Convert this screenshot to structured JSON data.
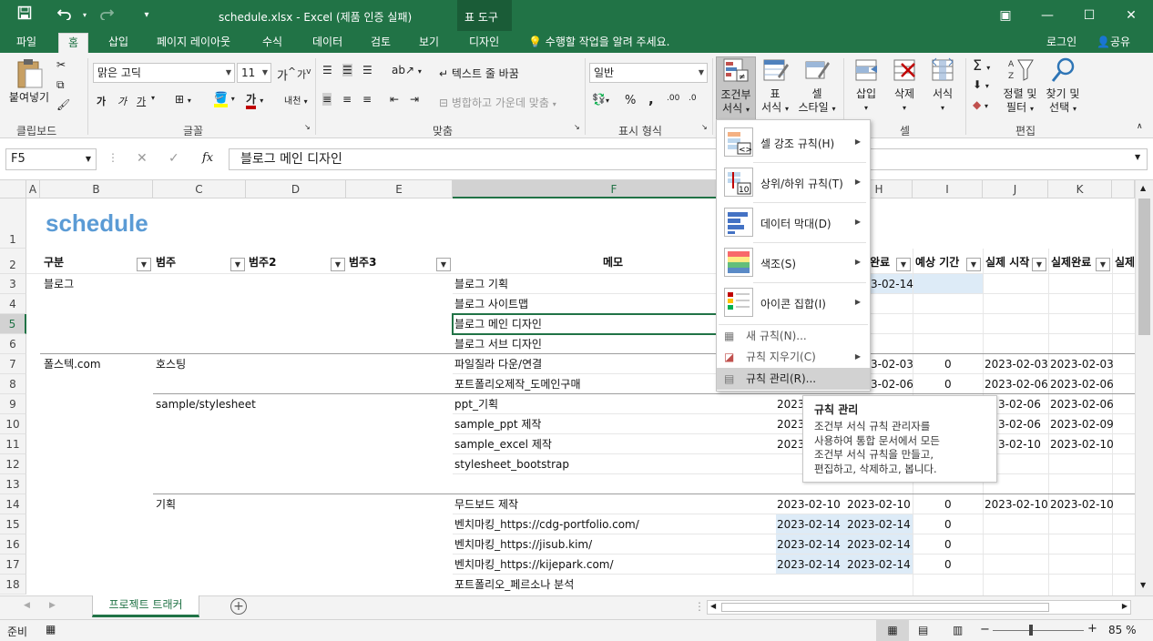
{
  "titlebar": {
    "title": "schedule.xlsx - Excel (제품 인증 실패)",
    "contextual_group": "표 도구",
    "qat_save": "save-icon",
    "qat_undo": "undo-icon",
    "qat_redo": "redo-icon"
  },
  "tabs": [
    "파일",
    "홈",
    "삽입",
    "페이지 레이아웃",
    "수식",
    "데이터",
    "검토",
    "보기",
    "디자인"
  ],
  "tell_me": "수행할 작업을 알려 주세요.",
  "login": "로그인",
  "share": "공유",
  "ribbon": {
    "clipboard": {
      "paste": "붙여넣기",
      "label": "클립보드"
    },
    "font": {
      "name": "맑은 고딕",
      "size": "11",
      "label": "글꼴",
      "bold": "가",
      "italic": "가",
      "underline": "가",
      "grow": "가",
      "shrink": "가",
      "fontcolor": "가",
      "phonetic": "내천"
    },
    "align": {
      "wrap": "텍스트 줄 바꿈",
      "merge": "병합하고 가운데 맞춤",
      "label": "맞춤"
    },
    "number": {
      "format": "일반",
      "percent": "%",
      "comma": ",",
      "label": "표시 형식"
    },
    "styles": {
      "cond": "조건부",
      "cond2": "서식",
      "table": "표",
      "table2": "서식",
      "cell": "셀",
      "cell2": "스타일"
    },
    "cells": {
      "insert": "삽입",
      "delete": "삭제",
      "format": "서식",
      "label": "셀"
    },
    "editing": {
      "sort": "정렬 및",
      "sort2": "필터",
      "find": "찾기 및",
      "find2": "선택",
      "label": "편집"
    }
  },
  "formula_bar": {
    "name_box": "F5",
    "fx": "fx",
    "value": "블로그 메인 디자인"
  },
  "columns": [
    "A",
    "B",
    "C",
    "D",
    "E",
    "F",
    "H",
    "I",
    "J",
    "K"
  ],
  "rows": [
    "1",
    "2",
    "3",
    "4",
    "5",
    "6",
    "7",
    "8",
    "9",
    "10",
    "11",
    "12",
    "13",
    "14",
    "15",
    "16",
    "17",
    "18"
  ],
  "sheet": {
    "title": "schedule",
    "headers": {
      "b": "구분",
      "c": "범주",
      "d": "범주2",
      "e": "범주3",
      "f": "메모",
      "h": "완료",
      "i": "예상 기간",
      "j": "실제 시작",
      "k": "실제완료",
      "l": "실제"
    },
    "cells": {
      "b3": "블로그",
      "f3": "블로그 기획",
      "h3": "3-02-14",
      "f4": "블로그 사이트맵",
      "f5": "블로그 메인 디자인",
      "f6": "블로그 서브 디자인",
      "b7": "폴스텍.com",
      "c7": "호스팅",
      "f7": "파일질라 다운/연결",
      "h7": "3-02-03",
      "i7": "0",
      "j7": "2023-02-03",
      "k7": "2023-02-03",
      "f8": "포트폴리오제작_도메인구매",
      "h8": "3-02-06",
      "i8": "0",
      "j8": "2023-02-06",
      "k8": "2023-02-06",
      "c9": "sample/stylesheet",
      "f9": "ppt_기획",
      "g9": "2023",
      "j9": "3-02-06",
      "k9": "2023-02-06",
      "f10": "sample_ppt 제작",
      "g10": "2023",
      "j10": "3-02-06",
      "k10": "2023-02-09",
      "f11": "sample_excel 제작",
      "g11": "2023",
      "j11": "3-02-10",
      "k11": "2023-02-10",
      "f12": "stylesheet_bootstrap",
      "c14": "기획",
      "f14": "무드보드 제작",
      "g14": "2023-02-10",
      "h14": "2023-02-10",
      "i14": "0",
      "j14": "2023-02-10",
      "k14": "2023-02-10",
      "f15": "벤치마킹_https://cdg-portfolio.com/",
      "g15": "2023-02-14",
      "h15": "2023-02-14",
      "i15": "0",
      "f16": "벤치마킹_https://jisub.kim/",
      "g16": "2023-02-14",
      "h16": "2023-02-14",
      "i16": "0",
      "f17": "벤치마킹_https://kijepark.com/",
      "g17": "2023-02-14",
      "h17": "2023-02-14",
      "i17": "0",
      "f18": "포트폴리오_페르소나 분석"
    }
  },
  "menu": {
    "items": [
      {
        "label": "셀 강조 규칙(H)",
        "icon": "highlight-rules-icon"
      },
      {
        "label": "상위/하위 규칙(T)",
        "icon": "top-bottom-rules-icon"
      },
      {
        "label": "데이터 막대(D)",
        "icon": "data-bars-icon"
      },
      {
        "label": "색조(S)",
        "icon": "color-scales-icon"
      },
      {
        "label": "아이콘 집합(I)",
        "icon": "icon-sets-icon"
      }
    ],
    "new_rule": "새 규칙(N)...",
    "clear_rules": "규칙 지우기(C)",
    "manage_rules": "규칙 관리(R)..."
  },
  "tooltip": {
    "title": "규칙 관리",
    "lines": [
      "조건부 서식 규칙 관리자를",
      "사용하여 통합 문서에서 모든",
      "조건부 서식 규칙을 만들고,",
      "편집하고, 삭제하고, 봅니다."
    ]
  },
  "sheet_tab": "프로젝트 트래커",
  "status": {
    "ready": "준비",
    "zoom": "85 %"
  },
  "colors": {
    "excel_green": "#217346",
    "accent_blue": "#5b9bd5",
    "highlight": "#ddebf7"
  }
}
